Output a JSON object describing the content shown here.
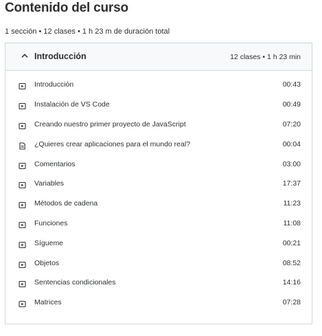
{
  "page": {
    "title": "Contenido del curso",
    "summary": "1 sección • 12 clases • 1 h 23 m de duración total"
  },
  "section": {
    "title": "Introducción",
    "meta": "12 clases • 1 h 23 min",
    "expanded": true,
    "lectures": [
      {
        "title": "Introducción",
        "duration": "00:43",
        "icon": "video-icon"
      },
      {
        "title": "Instalación de VS Code",
        "duration": "00:49",
        "icon": "video-icon"
      },
      {
        "title": "Creando nuestro primer proyecto de JavaScript",
        "duration": "07:20",
        "icon": "video-icon"
      },
      {
        "title": "¿Quieres crear aplicaciones para el mundo real?",
        "duration": "00:04",
        "icon": "article-icon"
      },
      {
        "title": "Comentarios",
        "duration": "03:00",
        "icon": "video-icon"
      },
      {
        "title": "Variables",
        "duration": "17:37",
        "icon": "video-icon"
      },
      {
        "title": "Métodos de cadena",
        "duration": "11:23",
        "icon": "video-icon"
      },
      {
        "title": "Funciones",
        "duration": "11:08",
        "icon": "video-icon"
      },
      {
        "title": "Sígueme",
        "duration": "00:21",
        "icon": "video-icon"
      },
      {
        "title": "Objetos",
        "duration": "08:52",
        "icon": "video-icon"
      },
      {
        "title": "Sentencias condicionales",
        "duration": "14:16",
        "icon": "video-icon"
      },
      {
        "title": "Matrices",
        "duration": "07:28",
        "icon": "video-icon"
      }
    ]
  }
}
